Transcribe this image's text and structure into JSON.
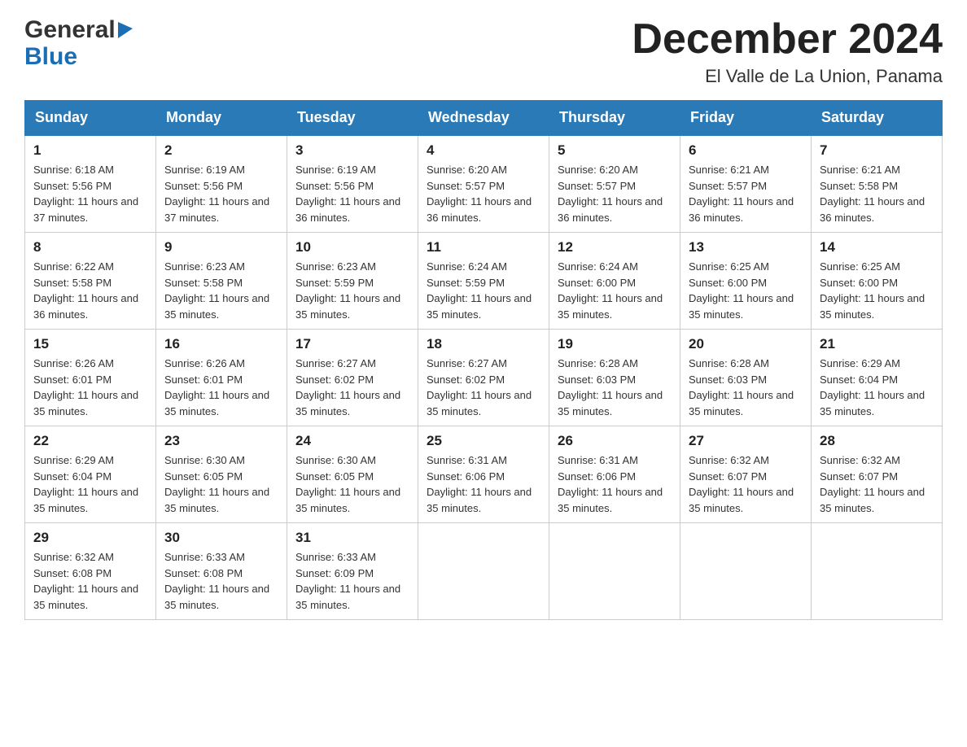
{
  "header": {
    "logo": {
      "general_text": "General",
      "blue_text": "Blue"
    },
    "title": "December 2024",
    "location": "El Valle de La Union, Panama"
  },
  "calendar": {
    "days_of_week": [
      "Sunday",
      "Monday",
      "Tuesday",
      "Wednesday",
      "Thursday",
      "Friday",
      "Saturday"
    ],
    "weeks": [
      [
        {
          "day": "1",
          "sunrise": "6:18 AM",
          "sunset": "5:56 PM",
          "daylight": "11 hours and 37 minutes."
        },
        {
          "day": "2",
          "sunrise": "6:19 AM",
          "sunset": "5:56 PM",
          "daylight": "11 hours and 37 minutes."
        },
        {
          "day": "3",
          "sunrise": "6:19 AM",
          "sunset": "5:56 PM",
          "daylight": "11 hours and 36 minutes."
        },
        {
          "day": "4",
          "sunrise": "6:20 AM",
          "sunset": "5:57 PM",
          "daylight": "11 hours and 36 minutes."
        },
        {
          "day": "5",
          "sunrise": "6:20 AM",
          "sunset": "5:57 PM",
          "daylight": "11 hours and 36 minutes."
        },
        {
          "day": "6",
          "sunrise": "6:21 AM",
          "sunset": "5:57 PM",
          "daylight": "11 hours and 36 minutes."
        },
        {
          "day": "7",
          "sunrise": "6:21 AM",
          "sunset": "5:58 PM",
          "daylight": "11 hours and 36 minutes."
        }
      ],
      [
        {
          "day": "8",
          "sunrise": "6:22 AM",
          "sunset": "5:58 PM",
          "daylight": "11 hours and 36 minutes."
        },
        {
          "day": "9",
          "sunrise": "6:23 AM",
          "sunset": "5:58 PM",
          "daylight": "11 hours and 35 minutes."
        },
        {
          "day": "10",
          "sunrise": "6:23 AM",
          "sunset": "5:59 PM",
          "daylight": "11 hours and 35 minutes."
        },
        {
          "day": "11",
          "sunrise": "6:24 AM",
          "sunset": "5:59 PM",
          "daylight": "11 hours and 35 minutes."
        },
        {
          "day": "12",
          "sunrise": "6:24 AM",
          "sunset": "6:00 PM",
          "daylight": "11 hours and 35 minutes."
        },
        {
          "day": "13",
          "sunrise": "6:25 AM",
          "sunset": "6:00 PM",
          "daylight": "11 hours and 35 minutes."
        },
        {
          "day": "14",
          "sunrise": "6:25 AM",
          "sunset": "6:00 PM",
          "daylight": "11 hours and 35 minutes."
        }
      ],
      [
        {
          "day": "15",
          "sunrise": "6:26 AM",
          "sunset": "6:01 PM",
          "daylight": "11 hours and 35 minutes."
        },
        {
          "day": "16",
          "sunrise": "6:26 AM",
          "sunset": "6:01 PM",
          "daylight": "11 hours and 35 minutes."
        },
        {
          "day": "17",
          "sunrise": "6:27 AM",
          "sunset": "6:02 PM",
          "daylight": "11 hours and 35 minutes."
        },
        {
          "day": "18",
          "sunrise": "6:27 AM",
          "sunset": "6:02 PM",
          "daylight": "11 hours and 35 minutes."
        },
        {
          "day": "19",
          "sunrise": "6:28 AM",
          "sunset": "6:03 PM",
          "daylight": "11 hours and 35 minutes."
        },
        {
          "day": "20",
          "sunrise": "6:28 AM",
          "sunset": "6:03 PM",
          "daylight": "11 hours and 35 minutes."
        },
        {
          "day": "21",
          "sunrise": "6:29 AM",
          "sunset": "6:04 PM",
          "daylight": "11 hours and 35 minutes."
        }
      ],
      [
        {
          "day": "22",
          "sunrise": "6:29 AM",
          "sunset": "6:04 PM",
          "daylight": "11 hours and 35 minutes."
        },
        {
          "day": "23",
          "sunrise": "6:30 AM",
          "sunset": "6:05 PM",
          "daylight": "11 hours and 35 minutes."
        },
        {
          "day": "24",
          "sunrise": "6:30 AM",
          "sunset": "6:05 PM",
          "daylight": "11 hours and 35 minutes."
        },
        {
          "day": "25",
          "sunrise": "6:31 AM",
          "sunset": "6:06 PM",
          "daylight": "11 hours and 35 minutes."
        },
        {
          "day": "26",
          "sunrise": "6:31 AM",
          "sunset": "6:06 PM",
          "daylight": "11 hours and 35 minutes."
        },
        {
          "day": "27",
          "sunrise": "6:32 AM",
          "sunset": "6:07 PM",
          "daylight": "11 hours and 35 minutes."
        },
        {
          "day": "28",
          "sunrise": "6:32 AM",
          "sunset": "6:07 PM",
          "daylight": "11 hours and 35 minutes."
        }
      ],
      [
        {
          "day": "29",
          "sunrise": "6:32 AM",
          "sunset": "6:08 PM",
          "daylight": "11 hours and 35 minutes."
        },
        {
          "day": "30",
          "sunrise": "6:33 AM",
          "sunset": "6:08 PM",
          "daylight": "11 hours and 35 minutes."
        },
        {
          "day": "31",
          "sunrise": "6:33 AM",
          "sunset": "6:09 PM",
          "daylight": "11 hours and 35 minutes."
        },
        null,
        null,
        null,
        null
      ]
    ]
  }
}
